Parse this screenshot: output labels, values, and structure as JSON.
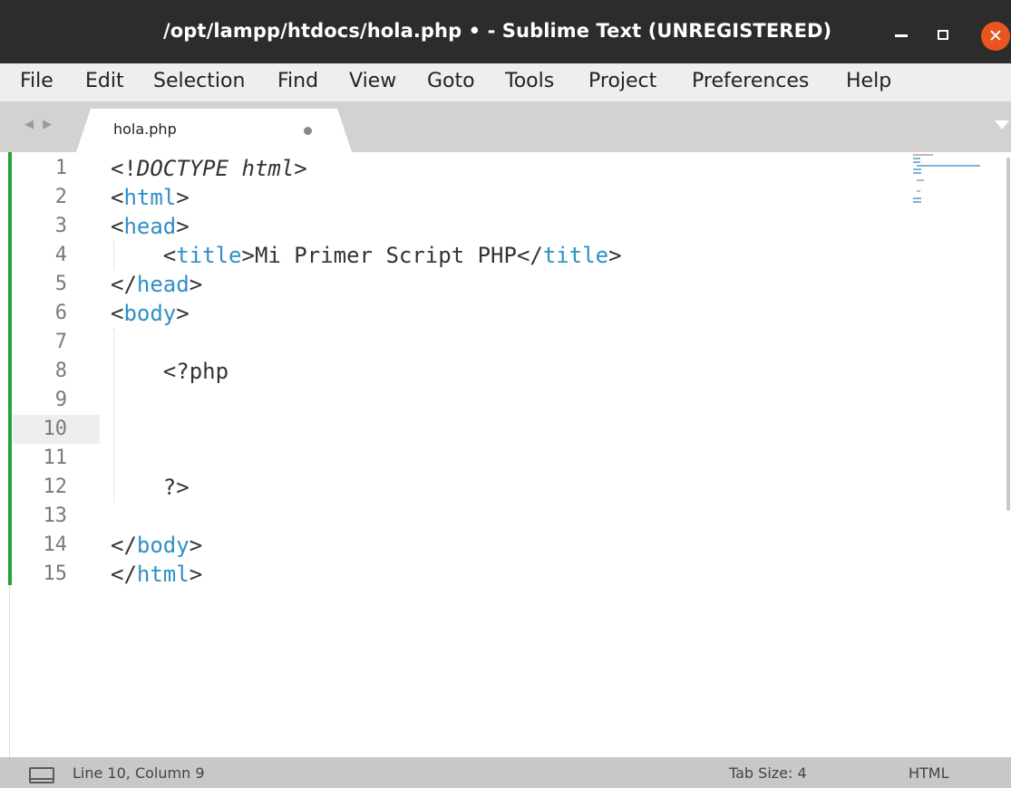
{
  "window": {
    "title": "/opt/lampp/htdocs/hola.php • - Sublime Text (UNREGISTERED)",
    "controls": {
      "close_glyph": "✕"
    }
  },
  "menu": {
    "items": [
      "File",
      "Edit",
      "Selection",
      "Find",
      "View",
      "Goto",
      "Tools",
      "Project",
      "Preferences",
      "Help"
    ]
  },
  "tabs": {
    "nav_arrows": "◀ ▶",
    "active": {
      "label": "hola.php",
      "modified": true
    }
  },
  "editor": {
    "active_line": 10,
    "line_numbers": [
      "1",
      "2",
      "3",
      "4",
      "5",
      "6",
      "7",
      "8",
      "9",
      "10",
      "11",
      "12",
      "13",
      "14",
      "15"
    ],
    "lines": [
      {
        "segments": [
          {
            "t": "<!",
            "c": "plain"
          },
          {
            "t": "DOCTYPE html",
            "c": "doctype"
          },
          {
            "t": ">",
            "c": "plain"
          }
        ]
      },
      {
        "segments": [
          {
            "t": "<",
            "c": "plain"
          },
          {
            "t": "html",
            "c": "tag"
          },
          {
            "t": ">",
            "c": "plain"
          }
        ]
      },
      {
        "segments": [
          {
            "t": "<",
            "c": "plain"
          },
          {
            "t": "head",
            "c": "tag"
          },
          {
            "t": ">",
            "c": "plain"
          }
        ]
      },
      {
        "segments": [
          {
            "t": "    <",
            "c": "plain"
          },
          {
            "t": "title",
            "c": "tag"
          },
          {
            "t": ">Mi Primer Script PHP</",
            "c": "plain"
          },
          {
            "t": "title",
            "c": "tag"
          },
          {
            "t": ">",
            "c": "plain"
          }
        ]
      },
      {
        "segments": [
          {
            "t": "</",
            "c": "plain"
          },
          {
            "t": "head",
            "c": "tag"
          },
          {
            "t": ">",
            "c": "plain"
          }
        ]
      },
      {
        "segments": [
          {
            "t": "<",
            "c": "plain"
          },
          {
            "t": "body",
            "c": "tag"
          },
          {
            "t": ">",
            "c": "plain"
          }
        ]
      },
      {
        "segments": []
      },
      {
        "segments": [
          {
            "t": "    <?php",
            "c": "plain"
          }
        ]
      },
      {
        "segments": []
      },
      {
        "segments": []
      },
      {
        "segments": []
      },
      {
        "segments": [
          {
            "t": "    ?>",
            "c": "plain"
          }
        ]
      },
      {
        "segments": []
      },
      {
        "segments": [
          {
            "t": "</",
            "c": "plain"
          },
          {
            "t": "body",
            "c": "tag"
          },
          {
            "t": ">",
            "c": "plain"
          }
        ]
      },
      {
        "segments": [
          {
            "t": "</",
            "c": "plain"
          },
          {
            "t": "html",
            "c": "tag"
          },
          {
            "t": ">",
            "c": "plain"
          }
        ]
      }
    ]
  },
  "colors": {
    "title_bar": "#2c2c2c",
    "close_button": "#e95420",
    "tag": "#2f8fc8",
    "change_marker": "#23a23e"
  },
  "status": {
    "position": "Line 10, Column 9",
    "tab_size": "Tab Size: 4",
    "syntax": "HTML"
  }
}
